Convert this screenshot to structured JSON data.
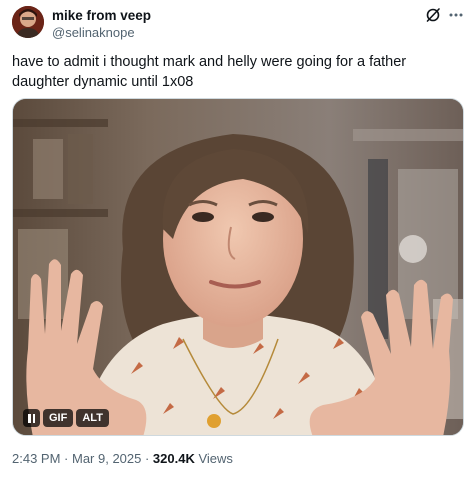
{
  "author": {
    "display_name": "mike from veep",
    "handle": "@selinaknope"
  },
  "icons": {
    "grok": "grok-icon",
    "more": "more-icon",
    "pause": "pause-icon"
  },
  "tweet": {
    "text": "have to admit i thought mark and helly were going for a father daughter dynamic until 1x08"
  },
  "media": {
    "gif_label": "GIF",
    "alt_label": "ALT"
  },
  "meta": {
    "time": "2:43 PM",
    "separator1": " · ",
    "date": "Mar 9, 2025",
    "separator2": " · ",
    "views_count": "320.4K",
    "views_label": " Views"
  },
  "colors": {
    "text_primary": "#0f1419",
    "text_secondary": "#536471",
    "border": "#cfd9de"
  }
}
